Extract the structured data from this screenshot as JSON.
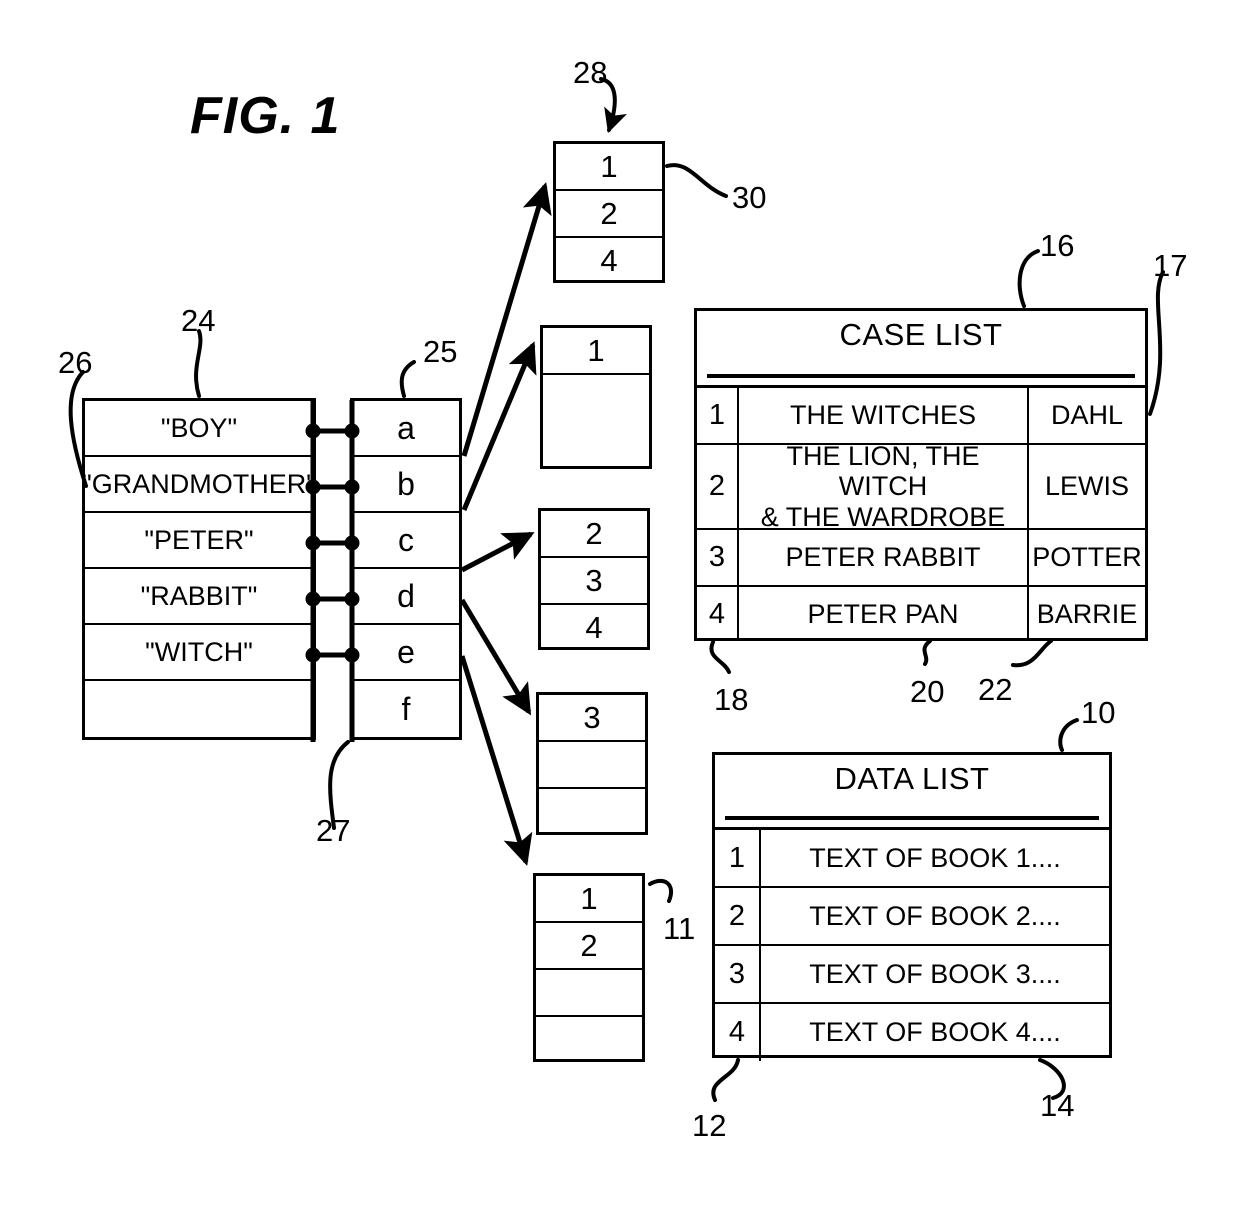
{
  "figure": {
    "title": "FIG. 1"
  },
  "word_list": {
    "ref": "26",
    "ref_top": "24",
    "rows": [
      {
        "label": "\"BOY\""
      },
      {
        "label": "\"GRANDMOTHER\""
      },
      {
        "label": "\"PETER\""
      },
      {
        "label": "\"RABBIT\""
      },
      {
        "label": "\"WITCH\""
      },
      {
        "label": ""
      }
    ]
  },
  "pointer_list": {
    "ref": "25",
    "rows": [
      {
        "label": "a"
      },
      {
        "label": "b"
      },
      {
        "label": "c"
      },
      {
        "label": "d"
      },
      {
        "label": "e"
      },
      {
        "label": "f"
      }
    ]
  },
  "connector": {
    "ref": "27",
    "pair_count": 5
  },
  "case_number_boxes": [
    {
      "ref": "28",
      "cell_ref": "30",
      "cells": [
        "1",
        "2",
        "4"
      ]
    },
    {
      "ref": "",
      "cell_ref": "",
      "cells": [
        "1",
        ""
      ]
    },
    {
      "ref": "",
      "cell_ref": "",
      "cells": [
        "2",
        "3",
        "4"
      ]
    },
    {
      "ref": "",
      "cell_ref": "",
      "cells": [
        "3",
        "",
        ""
      ]
    },
    {
      "ref": "11",
      "cell_ref": "",
      "cells": [
        "1",
        "2",
        "",
        ""
      ]
    }
  ],
  "case_list": {
    "ref_table": "16",
    "ref_right": "17",
    "ref_col_num": "18",
    "ref_col_title": "20",
    "ref_col_author": "22",
    "title": "CASE LIST",
    "rows": [
      {
        "num": "1",
        "title": "THE WITCHES",
        "author": "DAHL"
      },
      {
        "num": "2",
        "title": "THE LION, THE WITCH\n& THE WARDROBE",
        "author": "LEWIS"
      },
      {
        "num": "3",
        "title": "PETER RABBIT",
        "author": "POTTER"
      },
      {
        "num": "4",
        "title": "PETER PAN",
        "author": "BARRIE"
      }
    ]
  },
  "data_list": {
    "ref_table": "10",
    "ref_col_num": "12",
    "ref_col_text": "14",
    "ref_left": "11",
    "title": "DATA LIST",
    "rows": [
      {
        "num": "1",
        "text": "TEXT OF BOOK 1...."
      },
      {
        "num": "2",
        "text": "TEXT OF BOOK 2...."
      },
      {
        "num": "3",
        "text": "TEXT OF BOOK 3...."
      },
      {
        "num": "4",
        "text": "TEXT OF BOOK 4...."
      }
    ]
  },
  "colors": {
    "ink": "#000000",
    "paper": "#ffffff"
  }
}
